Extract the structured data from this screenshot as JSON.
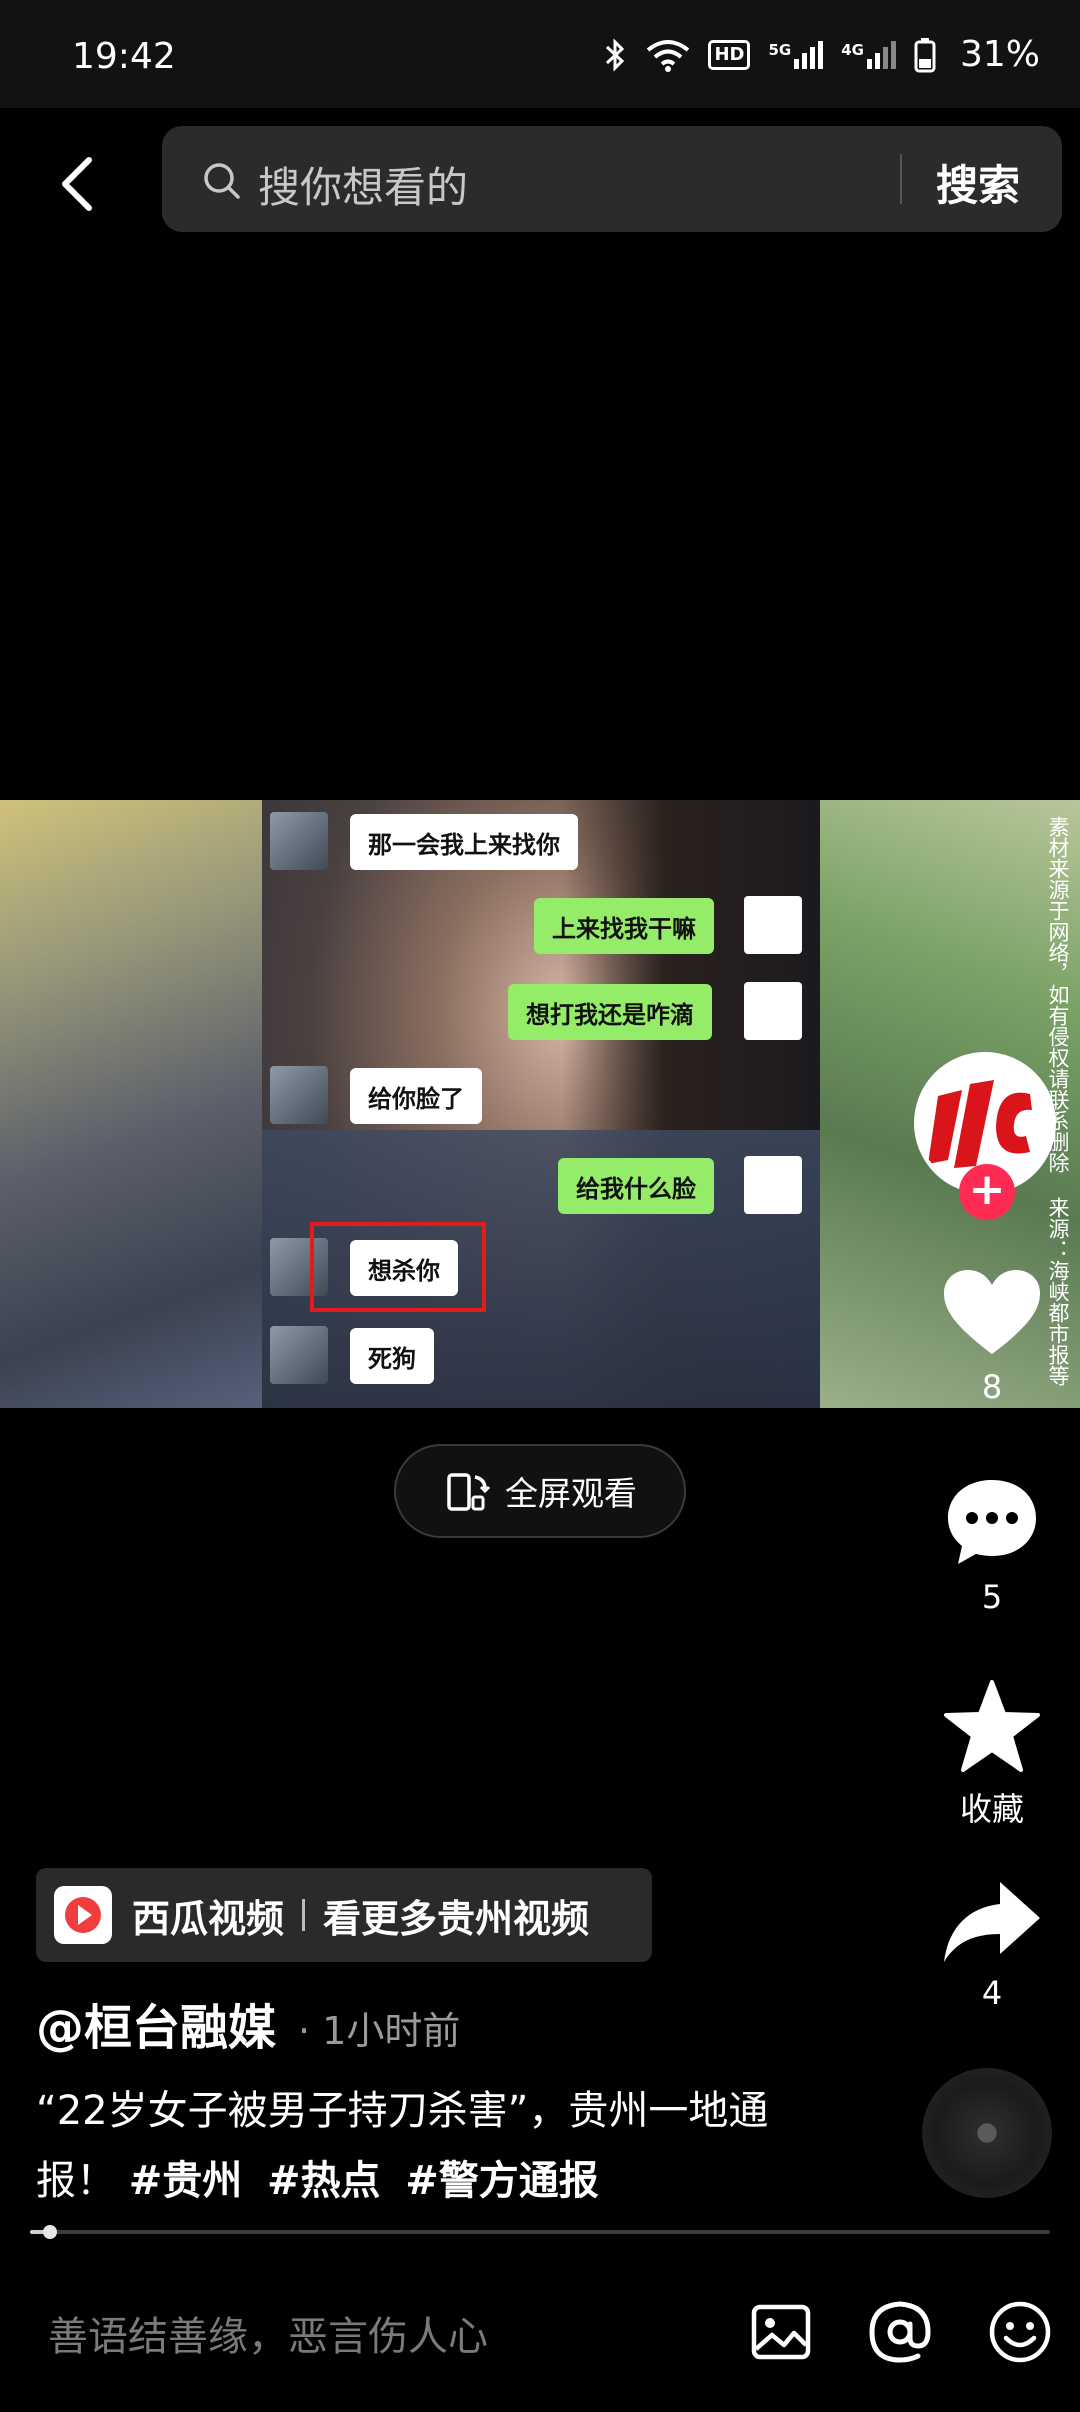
{
  "status_bar": {
    "time": "19:42",
    "battery": "31%",
    "icons": [
      "bluetooth-icon",
      "wifi-icon",
      "hd-icon",
      "5g-signal-icon",
      "4g-signal-icon",
      "battery-icon"
    ],
    "hd_label": "HD",
    "net1": "5G",
    "net2": "4G"
  },
  "search": {
    "placeholder": "搜你想看的",
    "button": "搜索"
  },
  "video": {
    "chat": [
      {
        "side": "left",
        "text": "那一会我上来找你"
      },
      {
        "side": "right",
        "text": "上来找我干嘛"
      },
      {
        "side": "right",
        "text": "想打我还是咋滴"
      },
      {
        "side": "left",
        "text": "给你脸了"
      },
      {
        "side": "right",
        "text": "给我什么脸"
      },
      {
        "side": "left",
        "text": "想杀你"
      },
      {
        "side": "left",
        "text": "死狗"
      }
    ],
    "watermark": "素材来源于网络，如有侵权请联系删除 来源：海峡都市报等"
  },
  "fullscreen": {
    "label": "全屏观看"
  },
  "side_rail": {
    "likes": "8",
    "comments": "5",
    "favorite_label": "收藏",
    "shares": "4",
    "follow_symbol": "+"
  },
  "source_card": {
    "app": "西瓜视频",
    "more": "看更多贵州视频"
  },
  "post": {
    "author": "@桓台融媒",
    "time": "· 1小时前",
    "caption": "“22岁女子被男子持刀杀害”，贵州一地通报！",
    "hashtags": [
      "#贵州",
      "#热点",
      "#警方通报"
    ]
  },
  "progress": {
    "fraction": 0.02
  },
  "comment_bar": {
    "placeholder": "善语结善缘，恶言伤人心"
  },
  "colors": {
    "accent": "#fe2c55",
    "chat_green": "#95ec69",
    "highlight": "#e21b1b"
  }
}
